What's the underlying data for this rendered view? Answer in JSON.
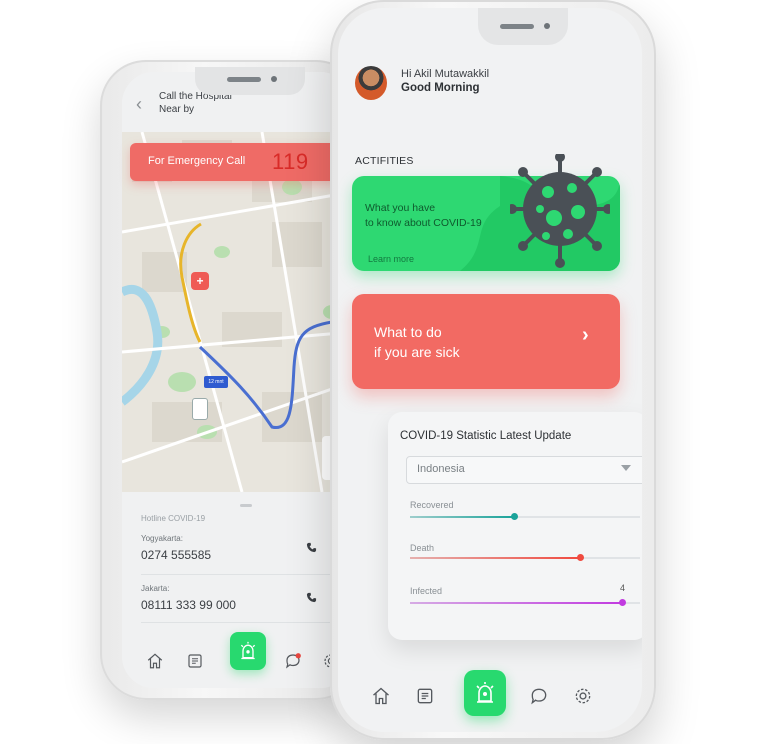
{
  "back_phone": {
    "header": {
      "title": "Call the Hospital\nNear by",
      "back_icon": "chevron-left-icon"
    },
    "emergency": {
      "label": "For Emergency Call",
      "number": "119"
    },
    "map": {
      "eta_badge": "12 mnt",
      "route_color_primary": "#4a6fd1",
      "route_color_secondary": "#e7b52a",
      "hospital_marker_color": "#ef5b55"
    },
    "hotline": {
      "title": "Hotline COVID-19",
      "entries": [
        {
          "city": "Yogyakarta:",
          "number": "0274 555585"
        },
        {
          "city": "Jakarta:",
          "number": "08111 333 99 000"
        }
      ]
    },
    "nav": [
      "home-icon",
      "news-icon",
      "siren-icon",
      "chat-icon",
      "settings-icon"
    ]
  },
  "front_phone": {
    "greeting": {
      "line1": "Hi Akil Mutawakkil",
      "line2": "Good Morning"
    },
    "section_title": "ACTIFITIES",
    "info_card": {
      "text": "What you have\nto know about COVID-19",
      "link": "Learn more",
      "color": "#2ed872"
    },
    "sick_card": {
      "text": "What to do\nif you are sick",
      "color": "#f26a63"
    },
    "stats": {
      "title": "COVID-19 Statistic Latest Update",
      "country": "Indonesia",
      "items": [
        {
          "label": "Recovered",
          "fraction": 0.45,
          "color": "#1aa39a"
        },
        {
          "label": "Death",
          "fraction": 0.74,
          "color": "#f04a3f"
        },
        {
          "label": "Infected",
          "fraction": 0.92,
          "color": "#c13be0",
          "value": "4"
        }
      ]
    },
    "nav": [
      "home-icon",
      "news-icon",
      "siren-icon",
      "chat-icon",
      "settings-icon"
    ]
  }
}
